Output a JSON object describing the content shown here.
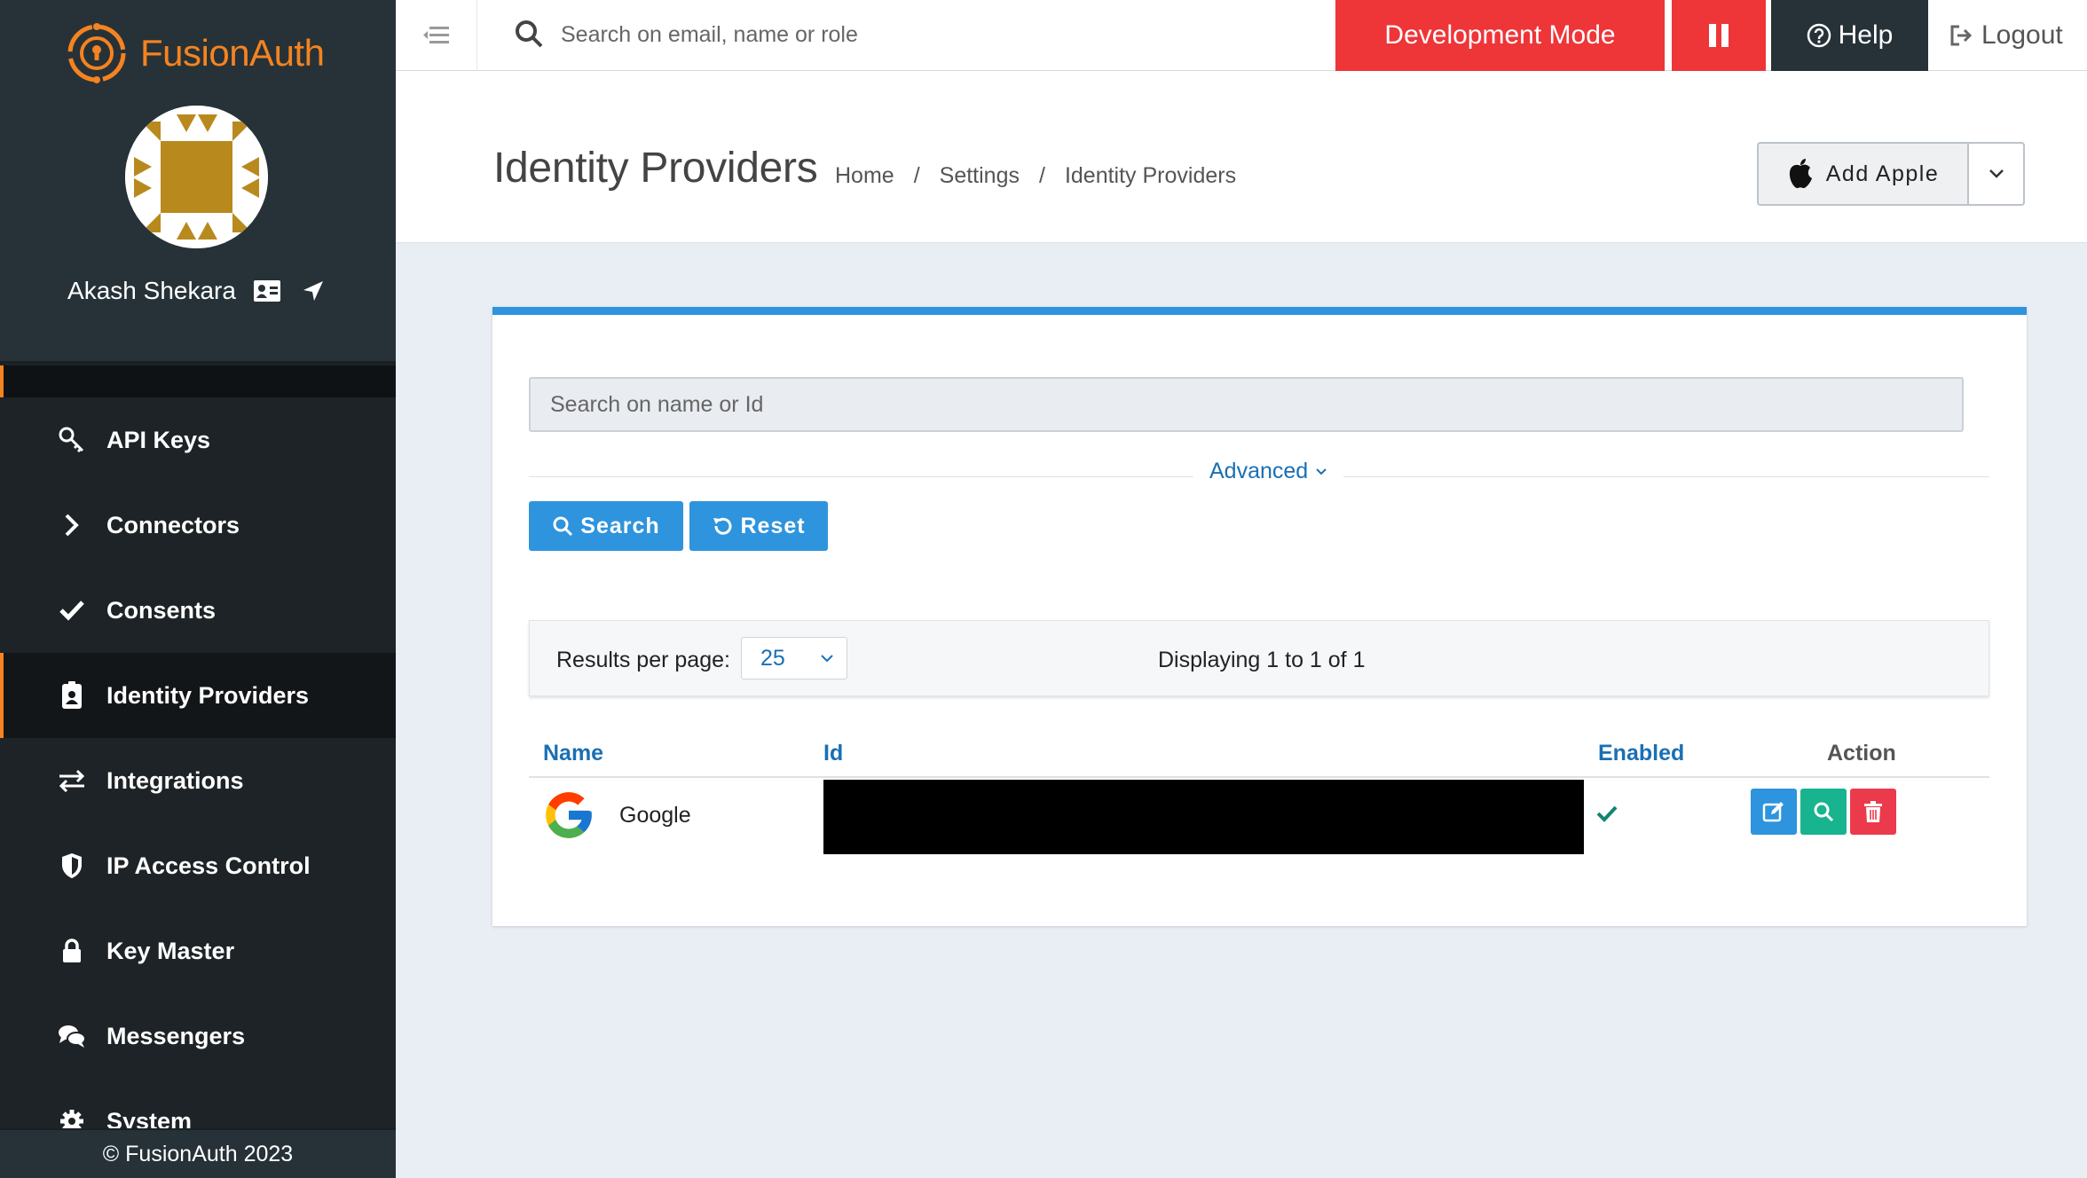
{
  "brand": {
    "name": "FusionAuth",
    "accent": "#f58320"
  },
  "user": {
    "name": "Akash Shekara"
  },
  "sidebar": {
    "items": [
      {
        "label": "API Keys",
        "icon": "key-icon",
        "active": false
      },
      {
        "label": "Connectors",
        "icon": "chevron-right-icon",
        "active": false
      },
      {
        "label": "Consents",
        "icon": "check-icon",
        "active": false
      },
      {
        "label": "Identity Providers",
        "icon": "id-badge-icon",
        "active": true
      },
      {
        "label": "Integrations",
        "icon": "exchange-icon",
        "active": false
      },
      {
        "label": "IP Access Control",
        "icon": "shield-icon",
        "active": false
      },
      {
        "label": "Key Master",
        "icon": "lock-icon",
        "active": false
      },
      {
        "label": "Messengers",
        "icon": "comments-icon",
        "active": false
      },
      {
        "label": "System",
        "icon": "gear-icon",
        "active": false
      }
    ],
    "footer": "© FusionAuth 2023"
  },
  "topbar": {
    "search_placeholder": "Search on email, name or role",
    "dev_mode": "Development Mode",
    "help": "Help",
    "logout": "Logout",
    "dev_color": "#ee3538",
    "help_color": "#263238"
  },
  "header": {
    "title": "Identity Providers",
    "breadcrumb": [
      "Home",
      "Settings",
      "Identity Providers"
    ],
    "add_button": "Add Apple"
  },
  "panel": {
    "search_placeholder": "Search on name or Id",
    "advanced": "Advanced",
    "search_button": "Search",
    "reset_button": "Reset",
    "accent": "#2e94dd"
  },
  "results": {
    "per_page_label": "Results per page:",
    "per_page_value": "25",
    "displaying": "Displaying 1 to 1 of 1"
  },
  "table": {
    "columns": [
      "Name",
      "Id",
      "Enabled",
      "Action"
    ],
    "rows": [
      {
        "name": "Google",
        "id": "",
        "enabled": true
      }
    ]
  }
}
